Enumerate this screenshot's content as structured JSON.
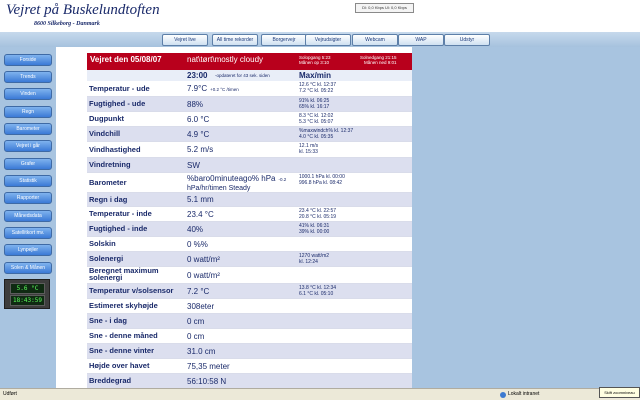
{
  "site": {
    "title": "Vejret på Buskelundtoften",
    "subtitle": "8600 Silkeborg - Danmark"
  },
  "net_status": "Dl: 0,0 Kbps  Ul: 0,0 Kbps",
  "topnav": [
    "Vejret live",
    "All time rekorder",
    "Borgervejr",
    "Vejrudsigter",
    "Webcam",
    "WAP",
    "Udstyr"
  ],
  "sidebar": [
    "Forside",
    "Trends",
    "Vinden",
    "Regn",
    "Barometer",
    "Vejret i går",
    "Grafer",
    "Statistik",
    "Rapporter",
    "Månedsdata",
    "Satellitkort mv.",
    "Lynpejler",
    "Solen & Månen"
  ],
  "lcd": {
    "temp": "5.6 °C",
    "clock": "18:43:59"
  },
  "header": {
    "title": "Vejret den 05/08/07",
    "conditions": "nat\\tørt\\mostly cloudy",
    "sunrise": [
      "Solopgang 5:23",
      "Månen op 3:10"
    ],
    "sunset": [
      "Solnedgang 21:15",
      "Månen ned 9:01"
    ]
  },
  "time_row": {
    "time": "23:00",
    "note": "-opdateret for 43 sek. siden",
    "minmax": "Max/min"
  },
  "rows": [
    {
      "label": "Temperatur - ude",
      "value": "7.9°C",
      "note": "+0.2 °C /timen",
      "mm": [
        "12.6 °C kl. 12:37",
        "7.2 °C kl. 05:22"
      ]
    },
    {
      "label": "Fugtighed - ude",
      "value": "88%",
      "note": "",
      "mm": [
        "91% kl. 06:25",
        "65% kl. 16:17"
      ]
    },
    {
      "label": "Dugpunkt",
      "value": "6.0 °C",
      "note": "",
      "mm": [
        "8.3 °C kl. 12:02",
        "5.3 °C kl. 05:07"
      ]
    },
    {
      "label": "Vindchill",
      "value": "4.9 °C",
      "note": "",
      "mm": [
        "%maxwindch% kl. 12:37",
        "4.0 °C kl. 05:35"
      ]
    },
    {
      "label": "Vindhastighed",
      "value": "5.2 m/s",
      "note": "",
      "mm": [
        "12.1 m/s",
        "kl. 15:33"
      ]
    },
    {
      "label": "Vindretning",
      "value": "SW",
      "note": "",
      "mm": []
    },
    {
      "label": "Barometer",
      "value": "%baro0minuteago% hPa",
      "note": "-0.2",
      "value2": "hPa/hr/timen Steady",
      "mm": [
        "1000.1 hPa kl. 00:00",
        "996.8 hPa kl. 08:42"
      ]
    },
    {
      "label": "Regn i dag",
      "value": "5.1 mm",
      "note": "",
      "mm": []
    },
    {
      "label": "Temperatur - inde",
      "value": "23.4 °C",
      "note": "",
      "mm": [
        "23.4 °C kl. 22:57",
        "20.8 °C kl. 05:19"
      ]
    },
    {
      "label": "Fugtighed - inde",
      "value": "40%",
      "note": "",
      "mm": [
        "41% kl. 06:31",
        "39% kl. 00:00"
      ]
    },
    {
      "label": "Solskin",
      "value": "0 %%",
      "note": "",
      "mm": []
    },
    {
      "label": "Solenergi",
      "value": "0 watt/m²",
      "note": "",
      "mm": [
        "1270 watt/m2",
        "kl. 12:24"
      ]
    },
    {
      "label": "Beregnet maximum solenergi",
      "value": "0 watt/m²",
      "note": "",
      "mm": []
    },
    {
      "label": "Temperatur v/solsensor",
      "value": "7.2 °C",
      "note": "",
      "mm": [
        "13.8 °C kl. 12:34",
        "6.1 °C kl. 05:10"
      ]
    },
    {
      "label": "Estimeret skyhøjde",
      "value": "308eter",
      "note": "",
      "mm": []
    },
    {
      "label": "Sne - i dag",
      "value": "0 cm",
      "note": "",
      "mm": []
    },
    {
      "label": "Sne - denne måned",
      "value": "0 cm",
      "note": "",
      "mm": []
    },
    {
      "label": "Sne - denne vinter",
      "value": "31.0 cm",
      "note": "",
      "mm": []
    },
    {
      "label": "Højde over havet",
      "value": "75,35 meter",
      "note": "",
      "mm": []
    },
    {
      "label": "Breddegrad",
      "value": "56:10:58 N",
      "note": "",
      "mm": []
    }
  ],
  "statusbar": {
    "text": "Udført",
    "zone": "Lokalt intranet",
    "zoom_tip": "Skift zoomniveau"
  }
}
